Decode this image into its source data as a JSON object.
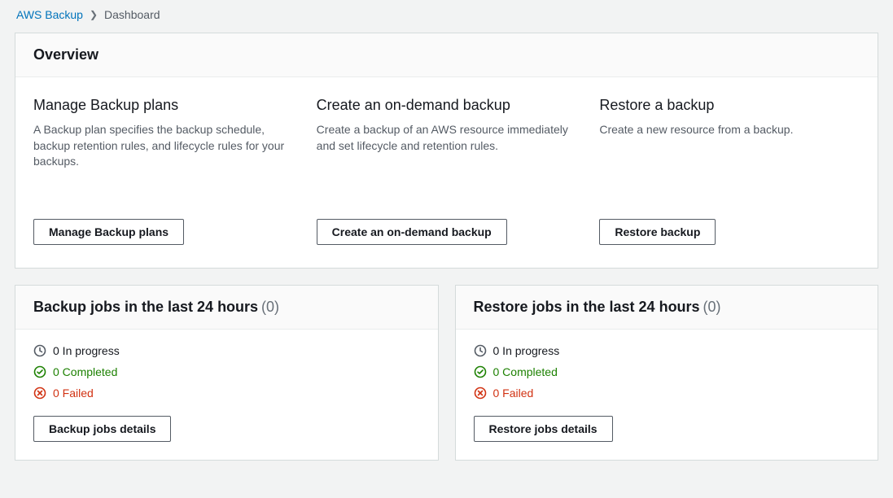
{
  "breadcrumb": {
    "root": "AWS Backup",
    "current": "Dashboard"
  },
  "overview": {
    "title": "Overview",
    "cards": [
      {
        "title": "Manage Backup plans",
        "desc": "A Backup plan specifies the backup schedule, backup retention rules, and lifecycle rules for your backups.",
        "button": "Manage Backup plans"
      },
      {
        "title": "Create an on-demand backup",
        "desc": "Create a backup of an AWS resource immediately and set lifecycle and retention rules.",
        "button": "Create an on-demand backup"
      },
      {
        "title": "Restore a backup",
        "desc": "Create a new resource from a backup.",
        "button": "Restore backup"
      }
    ]
  },
  "backupJobs": {
    "title": "Backup jobs in the last 24 hours",
    "count": "(0)",
    "inProgress": "0 In progress",
    "completed": "0 Completed",
    "failed": "0 Failed",
    "button": "Backup jobs details"
  },
  "restoreJobs": {
    "title": "Restore jobs in the last 24 hours",
    "count": "(0)",
    "inProgress": "0 In progress",
    "completed": "0 Completed",
    "failed": "0 Failed",
    "button": "Restore jobs details"
  }
}
